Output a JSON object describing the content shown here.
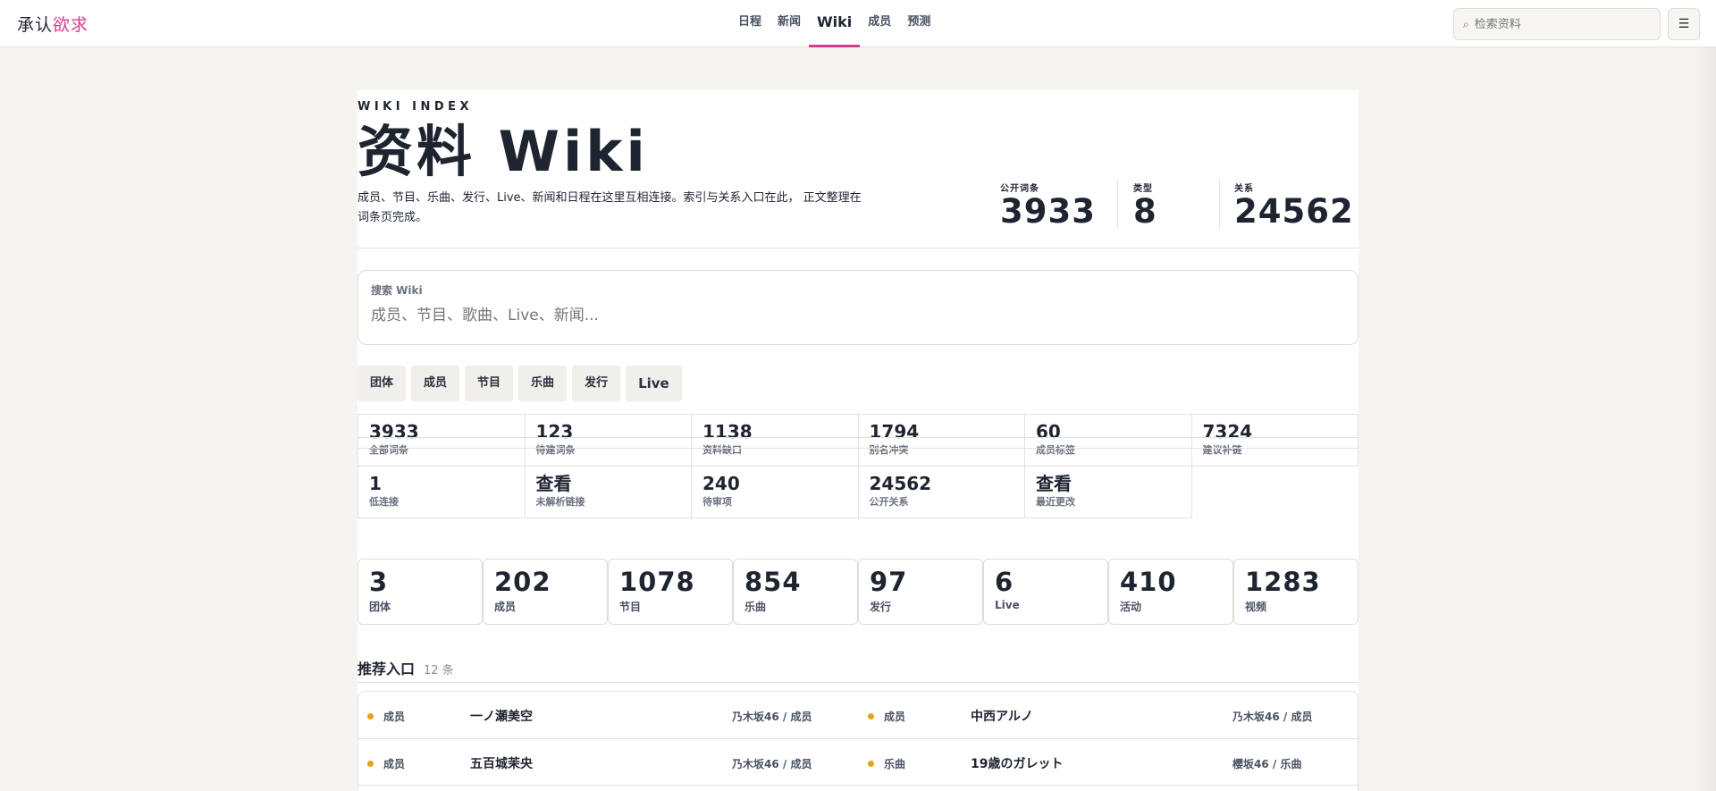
{
  "logo": {
    "part1": "承认",
    "part2": "欲求"
  },
  "nav": [
    {
      "label": "日程"
    },
    {
      "label": "新闻"
    },
    {
      "label": "Wiki",
      "active": true
    },
    {
      "label": "成员"
    },
    {
      "label": "预测"
    }
  ],
  "top_search": {
    "placeholder": "检索资料",
    "icon": "search-icon"
  },
  "menu_icon": "hamburger-icon",
  "hero": {
    "kicker": "WIKI INDEX",
    "title": "资料 Wiki",
    "description": "成员、节目、乐曲、发行、Live、新闻和日程在这里互相连接。索引与关系入口在此， 正文整理在词条页完成。"
  },
  "stats": [
    {
      "label": "公开词条",
      "value": "3933"
    },
    {
      "label": "类型",
      "value": "8"
    },
    {
      "label": "关系",
      "value": "24562"
    }
  ],
  "wiki_search": {
    "label": "搜索 Wiki",
    "placeholder": "成员、节目、歌曲、Live、新闻..."
  },
  "chips": [
    "团体",
    "成员",
    "节目",
    "乐曲",
    "发行",
    "Live"
  ],
  "maintenance": [
    {
      "value": "3933",
      "label": "全部词条"
    },
    {
      "value": "123",
      "label": "待建词条"
    },
    {
      "value": "1138",
      "label": "资料缺口"
    },
    {
      "value": "1794",
      "label": "别名冲突"
    },
    {
      "value": "60",
      "label": "成员标签"
    },
    {
      "value": "7324",
      "label": "建议补链"
    },
    {
      "value": "1",
      "label": "低连接"
    },
    {
      "value": "查看",
      "label": "未解析链接"
    },
    {
      "value": "240",
      "label": "待审项"
    },
    {
      "value": "24562",
      "label": "公开关系"
    },
    {
      "value": "查看",
      "label": "最近更改"
    }
  ],
  "types": [
    {
      "value": "3",
      "label": "团体"
    },
    {
      "value": "202",
      "label": "成员"
    },
    {
      "value": "1078",
      "label": "节目"
    },
    {
      "value": "854",
      "label": "乐曲"
    },
    {
      "value": "97",
      "label": "发行"
    },
    {
      "value": "6",
      "label": "Live"
    },
    {
      "value": "410",
      "label": "活动"
    },
    {
      "value": "1283",
      "label": "视频"
    }
  ],
  "recommended": {
    "title": "推荐入口",
    "count": "12 条",
    "dot_color": "#e8a21a",
    "rows": [
      [
        {
          "type": "成员",
          "name": "一ノ瀬美空",
          "path": "乃木坂46 / 成员"
        },
        {
          "type": "成员",
          "name": "中西アルノ",
          "path": "乃木坂46 / 成员"
        }
      ],
      [
        {
          "type": "成员",
          "name": "五百城茉央",
          "path": "乃木坂46 / 成员"
        },
        {
          "type": "乐曲",
          "name": "19歳のガレット",
          "path": "櫻坂46 / 乐曲"
        }
      ]
    ]
  },
  "colors": {
    "accent": "#d23f8e",
    "background": "#f5f4f0",
    "text": "#1e2430"
  }
}
